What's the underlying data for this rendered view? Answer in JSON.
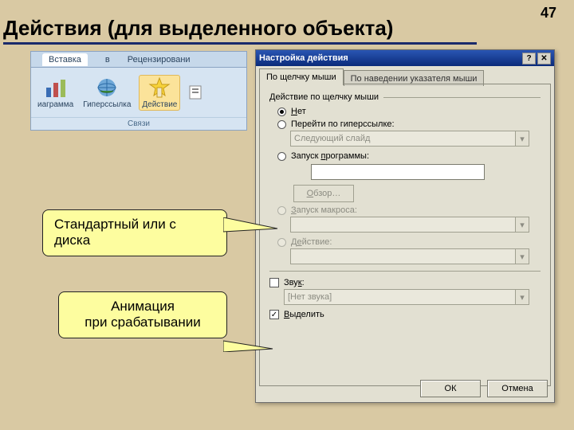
{
  "pagenum": "47",
  "title": "Действия (для выделенного объекта)",
  "ribbon": {
    "tab_insert": "Вставка",
    "tab_letter": "в",
    "tab_review": "Рецензировани",
    "item_chart": "иаграмма",
    "item_hyperlink": "Гиперссылка",
    "item_action": "Действие",
    "group_links": "Связи"
  },
  "callout1": "Стандартный или с диска",
  "callout2_line1": "Анимация",
  "callout2_line2": "при срабатывании",
  "dialog": {
    "title": "Настройка действия",
    "tab1": "По щелчку мыши",
    "tab2": "По наведении указателя мыши",
    "group": "Действие по щелчку мыши",
    "opt_none": "Нет",
    "opt_hyperlink": "Перейти по гиперссылке:",
    "combo_hyperlink": "Следующий слайд",
    "opt_run": "Запуск программы:",
    "btn_browse": "Обзор…",
    "opt_macro": "Запуск макроса:",
    "opt_action": "Действие:",
    "chk_sound": "Звук:",
    "combo_sound": "[Нет звука]",
    "chk_highlight": "Выделить",
    "btn_ok": "ОК",
    "btn_cancel": "Отмена"
  }
}
